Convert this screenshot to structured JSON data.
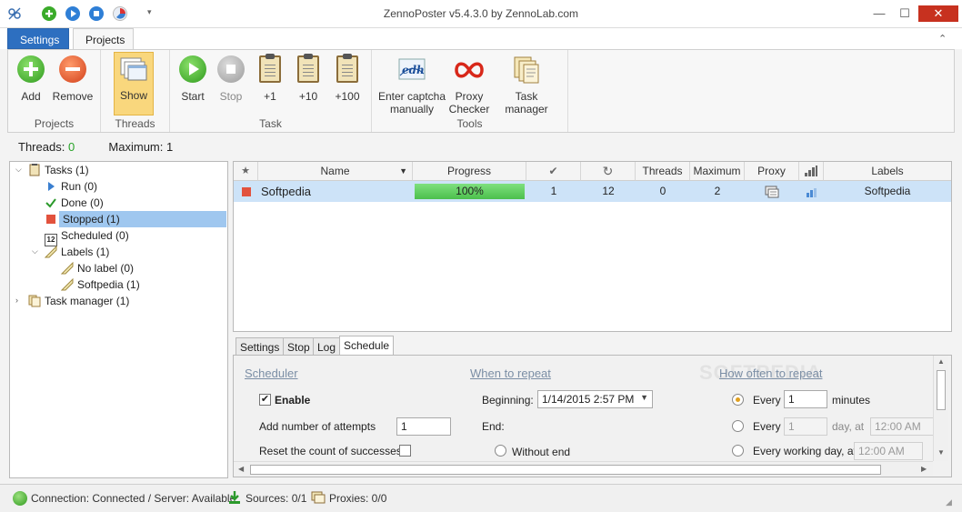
{
  "window": {
    "title": "ZennoPoster v5.4.3.0 by ZennoLab.com",
    "minimize": "—",
    "maximize": "☐",
    "close": "✕"
  },
  "ribbon_tabs": [
    {
      "label": "Settings",
      "state": "normal"
    },
    {
      "label": "Projects",
      "state": "selected"
    }
  ],
  "ribbon": {
    "groups": [
      {
        "label": "Projects",
        "buttons": [
          {
            "label": "Add",
            "icon": "add-icon"
          },
          {
            "label": "Remove",
            "icon": "remove-icon"
          }
        ]
      },
      {
        "label": "Threads",
        "buttons": [
          {
            "label": "Show",
            "icon": "show-threads-icon",
            "state": "active"
          }
        ]
      },
      {
        "label": "Task",
        "buttons": [
          {
            "label": "Start",
            "icon": "start-icon"
          },
          {
            "label": "Stop",
            "icon": "stop-icon",
            "state": "disabled"
          },
          {
            "label": "+1",
            "icon": "clipboard-icon"
          },
          {
            "label": "+10",
            "icon": "clipboard-icon"
          },
          {
            "label": "+100",
            "icon": "clipboard-icon"
          }
        ]
      },
      {
        "label": "Tools",
        "buttons": [
          {
            "label": "Enter captcha manually",
            "line1": "Enter captcha",
            "line2": "manually",
            "icon": "captcha-icon"
          },
          {
            "label": "Proxy Checker",
            "line1": "Proxy",
            "line2": "Checker",
            "icon": "proxy-checker-icon"
          },
          {
            "label": "Task manager",
            "icon": "task-manager-icon"
          }
        ]
      }
    ]
  },
  "threads_info": {
    "threads_label": "Threads:",
    "threads_value": "0",
    "maximum_label": "Maximum:",
    "maximum_value": "1"
  },
  "tree": {
    "tasks": "Tasks (1)",
    "run": "Run (0)",
    "done": "Done (0)",
    "stopped": "Stopped (1)",
    "scheduled": "Scheduled (0)",
    "scheduled_icon_text": "12",
    "labels": "Labels (1)",
    "no_label": "No label (0)",
    "softpedia": "Softpedia (1)",
    "task_manager": "Task manager (1)"
  },
  "grid": {
    "columns": {
      "star": "★",
      "name": "Name",
      "progress": "Progress",
      "check": "✔",
      "repeat": "↻",
      "threads": "Threads",
      "maximum": "Maximum",
      "proxy": "Proxy",
      "signal": "signal-icon",
      "labels": "Labels"
    },
    "rows": [
      {
        "name": "Softpedia",
        "progress_text": "100%",
        "progress_fraction": 1.0,
        "done": "1",
        "repeat": "12",
        "threads": "0",
        "maximum": "2",
        "labels": "Softpedia"
      }
    ]
  },
  "subtabs": [
    {
      "label": "Settings"
    },
    {
      "label": "Stop"
    },
    {
      "label": "Log"
    },
    {
      "label": "Schedule",
      "state": "active"
    }
  ],
  "schedule": {
    "scheduler_heading": "Scheduler",
    "when_heading": "When to repeat",
    "how_often_heading": "How often to repeat",
    "enable_label": "Enable",
    "enable_checked": true,
    "add_attempts_label": "Add number of attempts",
    "add_attempts_value": "1",
    "reset_label": "Reset the count of successes",
    "reset_checked": false,
    "beginning_label": "Beginning:",
    "beginning_value": "1/14/2015 2:57 PM",
    "end_label": "End:",
    "without_end_label": "Without end",
    "every_label": "Every",
    "every_value": "1",
    "minutes_label": "minutes",
    "every2_label": "Every",
    "every2_value": "1",
    "day_at_label": "day, at",
    "day_at_value": "12:00 AM",
    "working_day_label": "Every working day, at",
    "working_day_value": "12:00 AM"
  },
  "watermark": "SOFTPEDIA",
  "statusbar": {
    "connection": "Connection: Connected / Server: Available",
    "sources": "Sources: 0/1",
    "proxies": "Proxies: 0/0"
  },
  "colors": {
    "accent": "#2d6fc0",
    "progress_green": "#5fcf5f",
    "active_button": "#f9d77d",
    "selected_row": "#cde3f8",
    "tree_selected": "#9fc7ef"
  }
}
